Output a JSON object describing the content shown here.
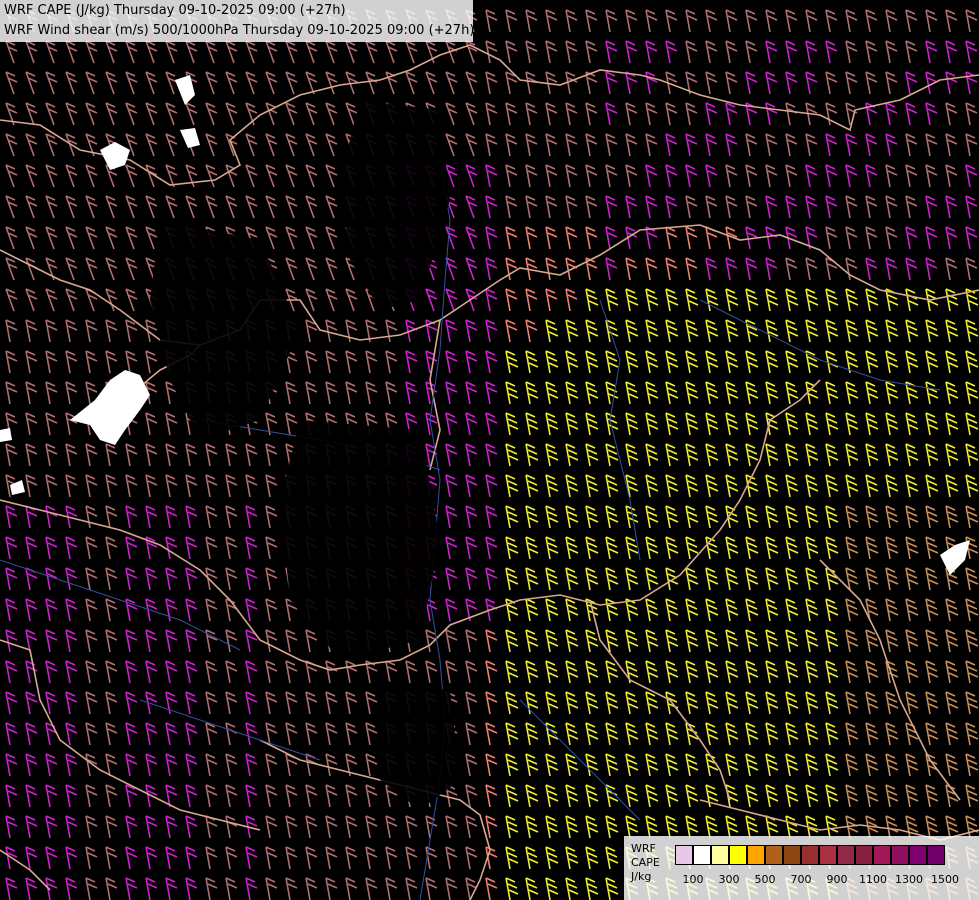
{
  "titles": {
    "cape": "WRF CAPE (J/kg) Thursday 09-10-2025 09:00 (+27h)",
    "shear": "WRF Wind shear (m/s) 500/1000hPa Thursday 09-10-2025 09:00 (+27h)"
  },
  "legend": {
    "label_lines": [
      "WRF",
      "CAPE",
      "J/kg"
    ],
    "swatches": [
      "#e8c8e8",
      "#ffffff",
      "#ffffa0",
      "#ffff00",
      "#ffa500",
      "#b06018",
      "#8b4513",
      "#983030",
      "#a83040",
      "#902848",
      "#882040",
      "#a01858",
      "#901060",
      "#800070",
      "#700068"
    ],
    "ticks": [
      "100",
      "300",
      "500",
      "700",
      "900",
      "1100",
      "1300",
      "1500"
    ]
  },
  "colors": {
    "background": "#000000",
    "border": "#d8a890",
    "river": "#3050a0",
    "cape_magenta": "#d020d0",
    "cape_yellow": "#f0f030",
    "shear_salmon": "#f08070",
    "shear_brown": "#b07070",
    "cloud_white": "#ffffff"
  }
}
